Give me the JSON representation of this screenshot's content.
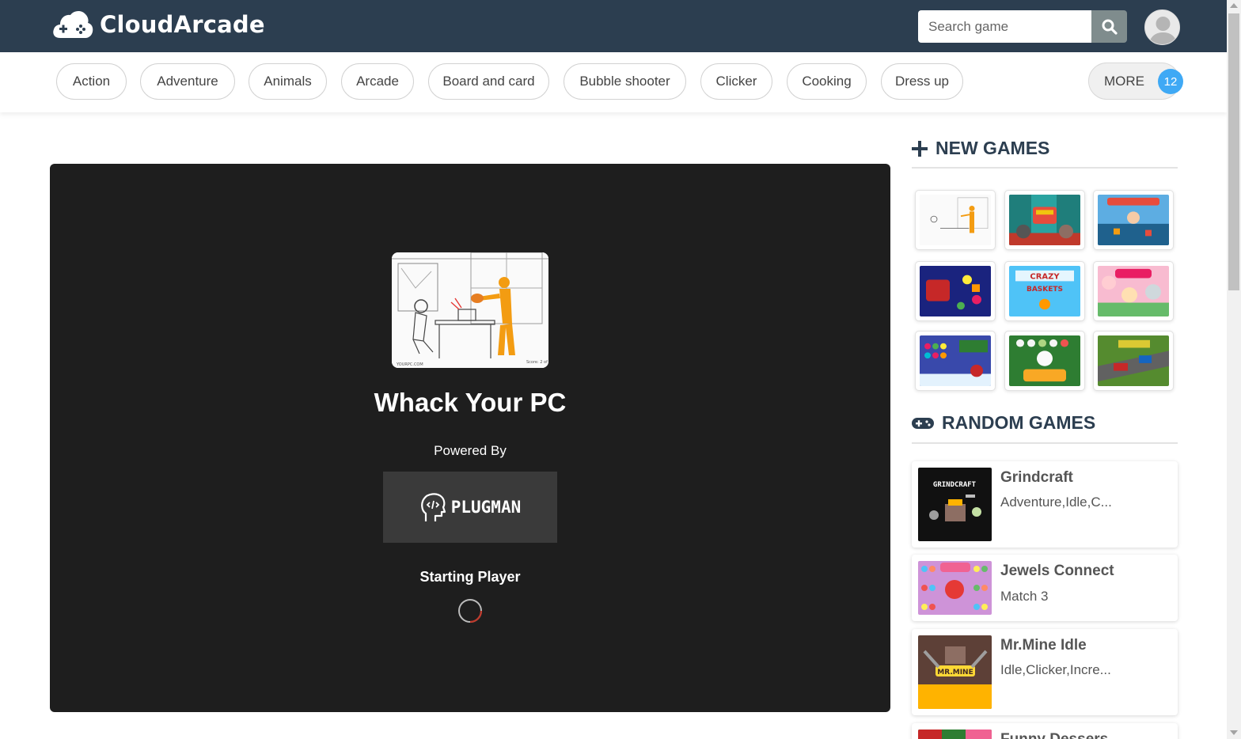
{
  "header": {
    "logo_text": "CloudArcade",
    "search_placeholder": "Search game"
  },
  "categories": [
    "Action",
    "Adventure",
    "Animals",
    "Arcade",
    "Board and card",
    "Bubble shooter",
    "Clicker",
    "Cooking",
    "Dress up"
  ],
  "more": {
    "label": "MORE",
    "count": "12"
  },
  "player": {
    "game_title": "Whack Your PC",
    "powered_by": "Powered By",
    "provider_logo": "PLUGMAN",
    "status": "Starting Player"
  },
  "sidebar": {
    "new_games_title": "NEW GAMES",
    "random_games_title": "RANDOM GAMES",
    "random_games": [
      {
        "name": "Grindcraft",
        "tags": "Adventure,Idle,C..."
      },
      {
        "name": "Jewels Connect",
        "tags": "Match 3"
      },
      {
        "name": "Mr.Mine Idle",
        "tags": "Idle,Clicker,Incre..."
      },
      {
        "name": "Funny Dessers",
        "tags": ""
      }
    ]
  },
  "colors": {
    "header_bg": "#2c3e50",
    "badge": "#3fa9f5",
    "player_bg": "#1e1e1e"
  }
}
